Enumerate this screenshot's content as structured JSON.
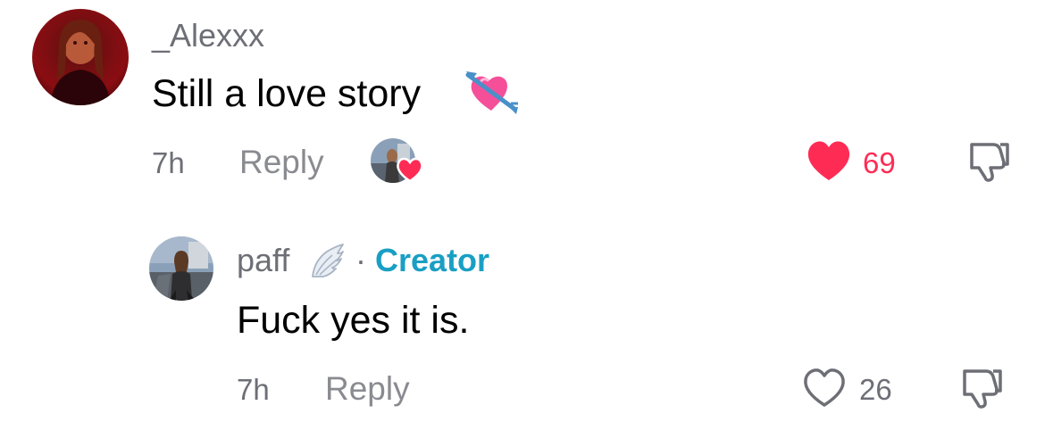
{
  "comments": [
    {
      "username": "_Alexxx",
      "text": "Still a love story",
      "emoji": "heart-with-arrow",
      "time": "7h",
      "reply_label": "Reply",
      "like_count": "69",
      "liked": true,
      "creator_liked": true
    },
    {
      "username": "paff",
      "username_emoji": "wing",
      "separator": "·",
      "tag": "Creator",
      "text": "Fuck yes it is.",
      "time": "7h",
      "reply_label": "Reply",
      "like_count": "26",
      "liked": false
    }
  ],
  "colors": {
    "like_red": "#fe2c55",
    "creator_blue": "#1a9fc4",
    "muted_gray": "#6e6f76"
  }
}
